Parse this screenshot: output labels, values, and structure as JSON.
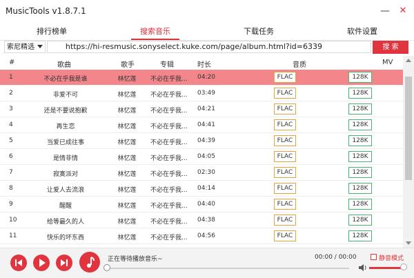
{
  "app": {
    "title": "MusicTools v1.8.7.1"
  },
  "window": {
    "minimize_glyph": "—",
    "close_glyph": "✕"
  },
  "tabs": [
    {
      "label": "排行榜单",
      "active": false
    },
    {
      "label": "搜索音乐",
      "active": true
    },
    {
      "label": "下载任务",
      "active": false
    },
    {
      "label": "软件设置",
      "active": false
    }
  ],
  "search": {
    "source_selected": "索尼精选",
    "query_value": "https://hi-resmusic.sonyselect.kuke.com/page/album.html?id=6339",
    "button_label": "搜 索"
  },
  "table": {
    "headers": {
      "index": "#",
      "song": "歌曲",
      "artist": "歌手",
      "album": "专辑",
      "duration": "时长",
      "quality": "音质",
      "mv": "MV"
    },
    "rows": [
      {
        "index": "1",
        "song": "不必在乎我是谁",
        "artist": "林忆莲",
        "album": "不必在乎我...",
        "duration": "04:20",
        "quality": "FLAC",
        "mv": "128K",
        "selected": true
      },
      {
        "index": "2",
        "song": "非爱不可",
        "artist": "林忆莲",
        "album": "不必在乎我...",
        "duration": "03:49",
        "quality": "FLAC",
        "mv": "128K",
        "selected": false
      },
      {
        "index": "3",
        "song": "还是不要说抱歉",
        "artist": "林忆莲",
        "album": "不必在乎我...",
        "duration": "04:21",
        "quality": "FLAC",
        "mv": "128K",
        "selected": false
      },
      {
        "index": "4",
        "song": "再生恋",
        "artist": "林忆莲",
        "album": "不必在乎我...",
        "duration": "04:41",
        "quality": "FLAC",
        "mv": "128K",
        "selected": false
      },
      {
        "index": "5",
        "song": "当爱已成往事",
        "artist": "林忆莲",
        "album": "不必在乎我...",
        "duration": "04:39",
        "quality": "FLAC",
        "mv": "128K",
        "selected": false
      },
      {
        "index": "6",
        "song": "是情非情",
        "artist": "林忆莲",
        "album": "不必在乎我...",
        "duration": "04:05",
        "quality": "FLAC",
        "mv": "128K",
        "selected": false
      },
      {
        "index": "7",
        "song": "寂寞派对",
        "artist": "林忆莲",
        "album": "不必在乎我...",
        "duration": "02:30",
        "quality": "FLAC",
        "mv": "128K",
        "selected": false
      },
      {
        "index": "8",
        "song": "让爱人去流浪",
        "artist": "林忆莲",
        "album": "不必在乎我...",
        "duration": "04:14",
        "quality": "FLAC",
        "mv": "128K",
        "selected": false
      },
      {
        "index": "9",
        "song": "醒醒",
        "artist": "林忆莲",
        "album": "不必在乎我...",
        "duration": "04:40",
        "quality": "FLAC",
        "mv": "128K",
        "selected": false
      },
      {
        "index": "10",
        "song": "给等最久的人",
        "artist": "林忆莲",
        "album": "不必在乎我...",
        "duration": "04:38",
        "quality": "FLAC",
        "mv": "128K",
        "selected": false
      },
      {
        "index": "11",
        "song": "快乐的坏东西",
        "artist": "林忆莲",
        "album": "不必在乎我...",
        "duration": "04:56",
        "quality": "FLAC",
        "mv": "128K",
        "selected": false
      }
    ]
  },
  "player": {
    "status": "正在等待播放音乐~",
    "time": "00:00 / 00:00",
    "mute_label": "静音模式",
    "mute_checked": false,
    "volume": 1.0
  },
  "colors": {
    "accent": "#e0353f",
    "selected_row": "#f2868b",
    "flac_border": "#e3a43a",
    "mv_border": "#45b66e"
  }
}
